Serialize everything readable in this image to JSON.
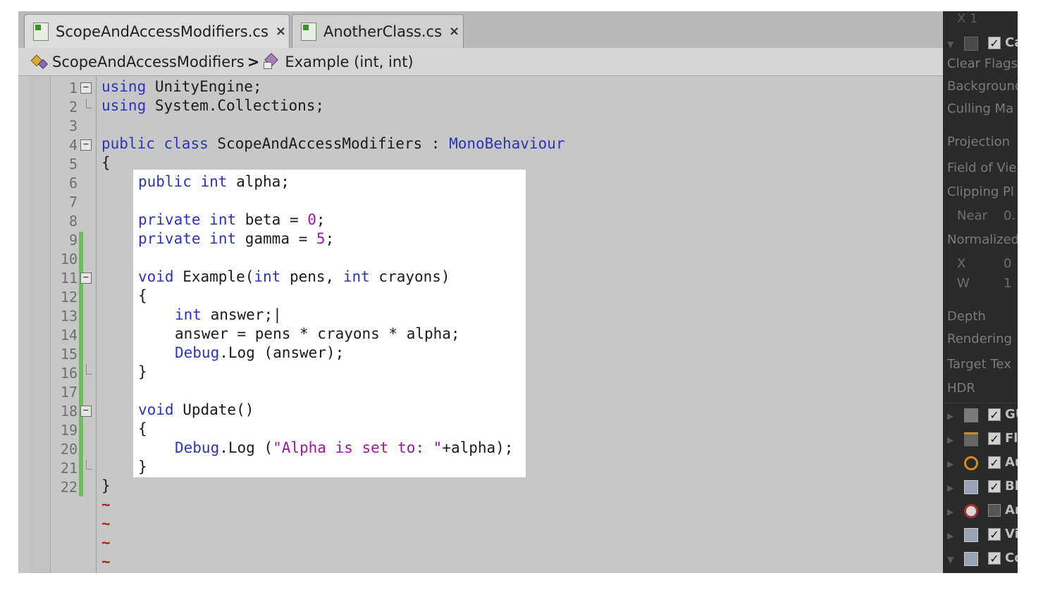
{
  "tabs": [
    {
      "label": "ScopeAndAccessModifiers.cs",
      "close": "×",
      "active": true
    },
    {
      "label": "AnotherClass.cs",
      "close": "×",
      "active": false
    }
  ],
  "breadcrumb": {
    "class_name": "ScopeAndAccessModifiers",
    "separator": ">",
    "method_name": "Example (int, int)"
  },
  "line_numbers": [
    "1",
    "2",
    "3",
    "4",
    "5",
    "6",
    "7",
    "8",
    "9",
    "10",
    "11",
    "12",
    "13",
    "14",
    "15",
    "16",
    "17",
    "18",
    "19",
    "20",
    "21",
    "22"
  ],
  "code": {
    "l1": {
      "kw": "using",
      "rest": " UnityEngine;"
    },
    "l2": {
      "kw": "using",
      "rest": " System.Collections;"
    },
    "l4": {
      "kw1": "public",
      "kw2": "class",
      "name": " ScopeAndAccessModifiers : ",
      "base": "MonoBehaviour"
    },
    "l5": "{",
    "l6": {
      "kw1": "public",
      "kw2": "int",
      "rest": " alpha;"
    },
    "l8": {
      "kw1": "private",
      "kw2": "int",
      "rest": " beta = ",
      "num": "0",
      "end": ";"
    },
    "l9": {
      "kw1": "private",
      "kw2": "int",
      "rest": " gamma = ",
      "num": "5",
      "end": ";"
    },
    "l11": {
      "kw": "void",
      "a": " Example(",
      "t1": "int",
      "b": " pens, ",
      "t2": "int",
      "c": " crayons)"
    },
    "l12": "{",
    "l13": {
      "kw": "int",
      "rest": " answer;|"
    },
    "l14": "answer = pens * crayons * alpha;",
    "l15": {
      "ty": "Debug",
      "rest": ".Log (answer);"
    },
    "l16": "}",
    "l18": {
      "kw": "void",
      "rest": " Update()"
    },
    "l19": "{",
    "l20": {
      "ty": "Debug",
      "a": ".Log (",
      "str": "\"Alpha is set to: \"",
      "b": "+alpha);"
    },
    "l21": "}",
    "l22": "}",
    "tilde": "~"
  },
  "inspector": {
    "top": "X  1",
    "camera_label": "Ca",
    "labels": [
      "Clear Flags",
      "Background",
      "Culling Ma",
      "Projection",
      "Field of Vie",
      "Clipping Pl",
      "Normalized",
      "Depth",
      "Rendering",
      "Target Tex",
      "HDR"
    ],
    "near_label": "Near",
    "near_value": "0.",
    "x_label": "X",
    "x_value": "0",
    "w_label": "W",
    "w_value": "1",
    "components": [
      {
        "text": "GU",
        "checked": true,
        "icon": "gui-layer-icon"
      },
      {
        "text": "Fl",
        "checked": true,
        "icon": "flare-layer-icon"
      },
      {
        "text": "Au",
        "checked": true,
        "icon": "audio-listener-icon"
      },
      {
        "text": "Bl",
        "checked": true,
        "icon": "js-script-icon"
      },
      {
        "text": "An",
        "checked": false,
        "icon": "animation-icon"
      },
      {
        "text": "Vi",
        "checked": true,
        "icon": "js-script-icon"
      },
      {
        "text": "Co",
        "checked": true,
        "icon": "js-script-icon"
      }
    ]
  },
  "colors": {
    "keyword": "#2b34b8",
    "number": "#a0169c",
    "changebar": "#6cbf59"
  }
}
